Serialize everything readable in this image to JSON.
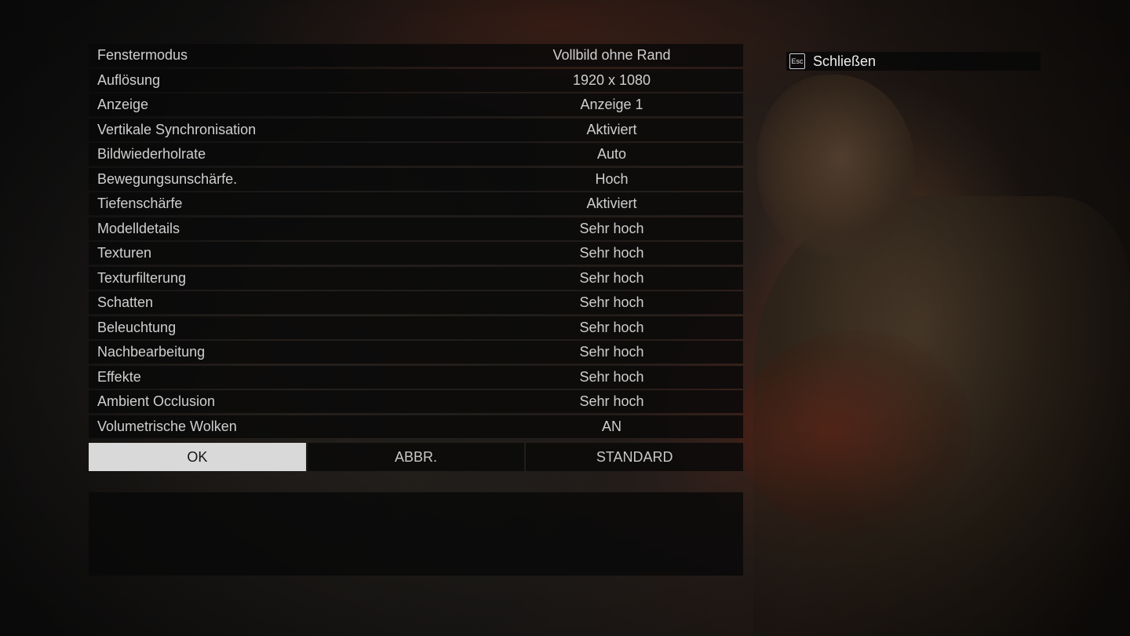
{
  "settings": [
    {
      "label": "Fenstermodus",
      "value": "Vollbild ohne Rand"
    },
    {
      "label": "Auflösung",
      "value": "1920 x 1080"
    },
    {
      "label": "Anzeige",
      "value": "Anzeige 1"
    },
    {
      "label": "Vertikale Synchronisation",
      "value": "Aktiviert"
    },
    {
      "label": "Bildwiederholrate",
      "value": "Auto"
    },
    {
      "label": "Bewegungsunschärfe.",
      "value": "Hoch"
    },
    {
      "label": "Tiefenschärfe",
      "value": "Aktiviert"
    },
    {
      "label": "Modelldetails",
      "value": "Sehr hoch"
    },
    {
      "label": "Texturen",
      "value": "Sehr hoch"
    },
    {
      "label": "Texturfilterung",
      "value": "Sehr hoch"
    },
    {
      "label": "Schatten",
      "value": "Sehr hoch"
    },
    {
      "label": "Beleuchtung",
      "value": "Sehr hoch"
    },
    {
      "label": "Nachbearbeitung",
      "value": "Sehr hoch"
    },
    {
      "label": "Effekte",
      "value": "Sehr hoch"
    },
    {
      "label": "Ambient Occlusion",
      "value": "Sehr hoch"
    },
    {
      "label": "Volumetrische Wolken",
      "value": "AN"
    }
  ],
  "buttons": {
    "ok": "OK",
    "cancel": "ABBR.",
    "default": "STANDARD"
  },
  "close": {
    "key": "Esc",
    "label": "Schließen",
    "icon": "esc-key-icon"
  },
  "colors": {
    "active_button_bg": "#d9d9d9",
    "row_bg": "#080808",
    "text": "#cfcfcf"
  }
}
